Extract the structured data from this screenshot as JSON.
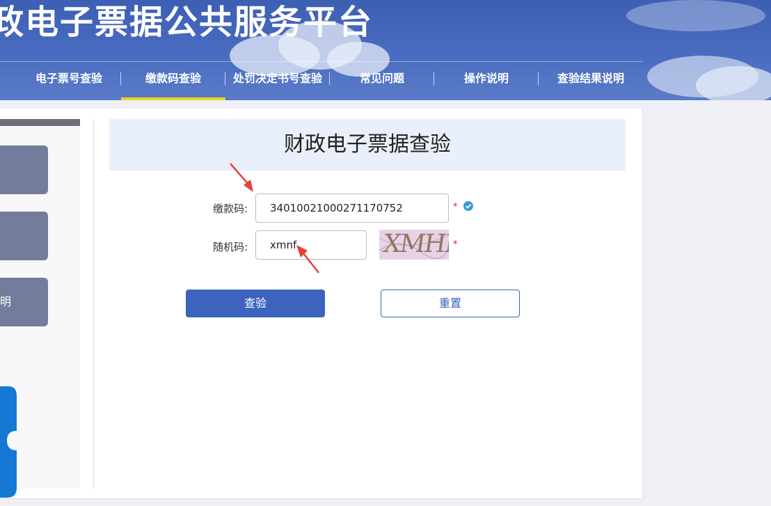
{
  "header": {
    "site_title": "政电子票据公共服务平台",
    "nav": [
      {
        "label": "电子票号查验"
      },
      {
        "label": "缴款码查验"
      },
      {
        "label": "处罚决定书号查验"
      },
      {
        "label": "常见问题"
      },
      {
        "label": "操作说明"
      },
      {
        "label": "查验结果说明"
      }
    ],
    "active_nav_index": 1
  },
  "sidebar": {
    "items": [
      {
        "label": ""
      },
      {
        "label": ""
      },
      {
        "label": "明"
      }
    ]
  },
  "form": {
    "title": "财政电子票据查验",
    "payment_code_label": "缴款码:",
    "payment_code_value": "34010021000271170752",
    "captcha_label": "随机码:",
    "captcha_value": "xmnf",
    "captcha_image_text": "XMHF",
    "required_mark": "*",
    "submit_label": "查验",
    "reset_label": "重置"
  },
  "colors": {
    "header_blue": "#4a6cc0",
    "active_underline": "#f2d21a",
    "primary_button": "#3c63be",
    "required": "#e02020",
    "annotation_arrow": "#e8413b"
  },
  "icons": [
    "check-circle-icon",
    "red-arrow-icon",
    "app-logo-icon"
  ]
}
